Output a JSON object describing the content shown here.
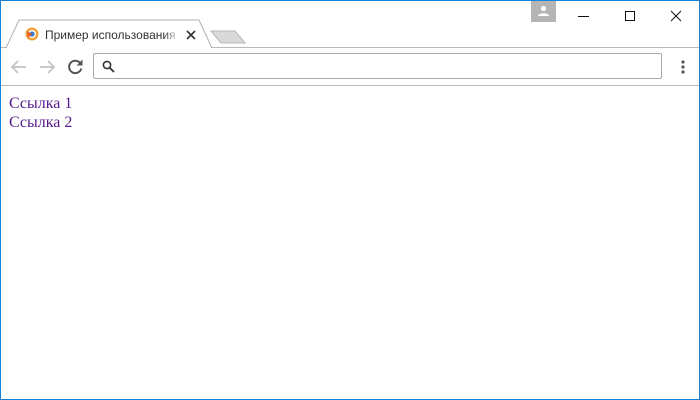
{
  "browser": {
    "tab": {
      "title": "Пример использования"
    },
    "omnibox": {
      "value": "",
      "placeholder": ""
    }
  },
  "page": {
    "links": [
      {
        "label": "Ссылка 1"
      },
      {
        "label": "Ссылка 2"
      }
    ]
  },
  "colors": {
    "window_border": "#1883d7",
    "visited_link": "#551a8b",
    "profile_button": "#b5b5b5"
  },
  "icons": [
    "favicon-icon",
    "tab-close-icon",
    "new-tab-icon",
    "profile-icon",
    "minimize-icon",
    "maximize-icon",
    "window-close-icon",
    "back-arrow-icon",
    "forward-arrow-icon",
    "reload-icon",
    "search-icon",
    "kebab-menu-icon"
  ]
}
